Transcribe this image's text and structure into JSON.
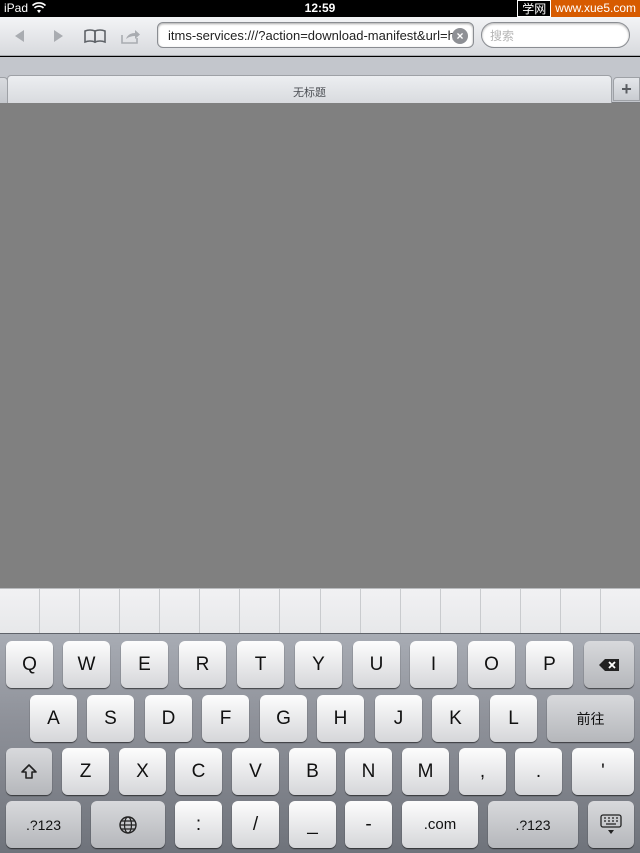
{
  "status_bar": {
    "device": "iPad",
    "time": "12:59",
    "watermark_cn": "学网",
    "watermark_url": "www.xue5.com"
  },
  "toolbar": {
    "url": "itms-services:///?action=download-manifest&url=h",
    "search_placeholder": "搜索"
  },
  "tabs": [
    {
      "title": "无标题"
    }
  ],
  "keyboard": {
    "row1": [
      "Q",
      "W",
      "E",
      "R",
      "T",
      "Y",
      "U",
      "I",
      "O",
      "P"
    ],
    "row2": [
      "A",
      "S",
      "D",
      "F",
      "G",
      "H",
      "J",
      "K",
      "L"
    ],
    "go_label": "前往",
    "row3": [
      "Z",
      "X",
      "C",
      "V",
      "B",
      "N",
      "M",
      ",",
      ".",
      "'"
    ],
    "numbers_label": ".?123",
    "row4_symbols": [
      ":",
      "/",
      "_",
      "-"
    ],
    "dotcom_label": ".com"
  },
  "colors": {
    "content_bg": "#808080",
    "toolbar_bg": "#e4e6ea",
    "watermark_accent": "#d75b00"
  },
  "icons": [
    "back-icon",
    "forward-icon",
    "bookmarks-icon",
    "share-icon",
    "wifi-icon",
    "clear-icon",
    "new-tab-icon",
    "backspace-icon",
    "shift-icon",
    "globe-icon",
    "hide-keyboard-icon"
  ]
}
